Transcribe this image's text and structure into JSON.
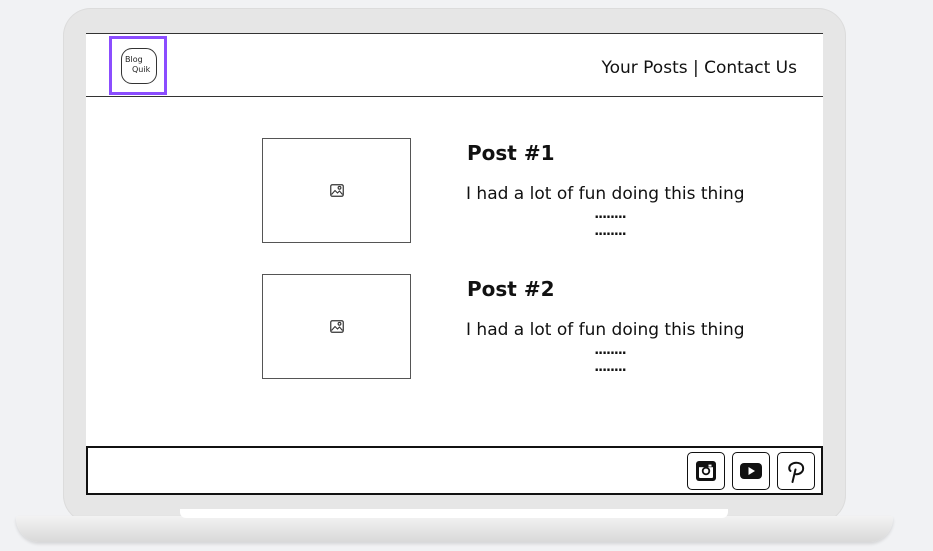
{
  "logo": {
    "line1": "Blog",
    "line2": "Quik"
  },
  "nav": {
    "your_posts": "Your Posts",
    "separator": " | ",
    "contact_us": "Contact Us"
  },
  "posts": [
    {
      "title": "Post #1",
      "excerpt": "I had a lot of fun doing this thing",
      "dots1": "........",
      "dots2": "........",
      "image_icon": "image-icon"
    },
    {
      "title": "Post #2",
      "excerpt": "I had a lot of fun doing this thing",
      "dots1": "........",
      "dots2": "........",
      "image_icon": "image-icon"
    }
  ],
  "footer": {
    "social_icons": [
      "instagram-icon",
      "youtube-icon",
      "pinterest-icon"
    ]
  },
  "colors": {
    "logo_highlight": "#8b4dff",
    "frame": "#e6e6e6",
    "background": "#f1f2f4"
  }
}
